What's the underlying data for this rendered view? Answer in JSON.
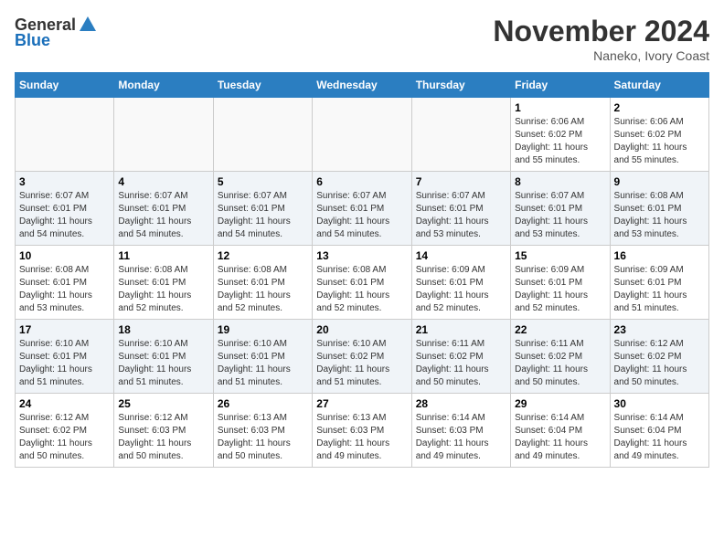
{
  "header": {
    "logo_general": "General",
    "logo_blue": "Blue",
    "month_title": "November 2024",
    "location": "Naneko, Ivory Coast"
  },
  "weekdays": [
    "Sunday",
    "Monday",
    "Tuesday",
    "Wednesday",
    "Thursday",
    "Friday",
    "Saturday"
  ],
  "weeks": [
    [
      {
        "day": "",
        "info": ""
      },
      {
        "day": "",
        "info": ""
      },
      {
        "day": "",
        "info": ""
      },
      {
        "day": "",
        "info": ""
      },
      {
        "day": "",
        "info": ""
      },
      {
        "day": "1",
        "info": "Sunrise: 6:06 AM\nSunset: 6:02 PM\nDaylight: 11 hours\nand 55 minutes."
      },
      {
        "day": "2",
        "info": "Sunrise: 6:06 AM\nSunset: 6:02 PM\nDaylight: 11 hours\nand 55 minutes."
      }
    ],
    [
      {
        "day": "3",
        "info": "Sunrise: 6:07 AM\nSunset: 6:01 PM\nDaylight: 11 hours\nand 54 minutes."
      },
      {
        "day": "4",
        "info": "Sunrise: 6:07 AM\nSunset: 6:01 PM\nDaylight: 11 hours\nand 54 minutes."
      },
      {
        "day": "5",
        "info": "Sunrise: 6:07 AM\nSunset: 6:01 PM\nDaylight: 11 hours\nand 54 minutes."
      },
      {
        "day": "6",
        "info": "Sunrise: 6:07 AM\nSunset: 6:01 PM\nDaylight: 11 hours\nand 54 minutes."
      },
      {
        "day": "7",
        "info": "Sunrise: 6:07 AM\nSunset: 6:01 PM\nDaylight: 11 hours\nand 53 minutes."
      },
      {
        "day": "8",
        "info": "Sunrise: 6:07 AM\nSunset: 6:01 PM\nDaylight: 11 hours\nand 53 minutes."
      },
      {
        "day": "9",
        "info": "Sunrise: 6:08 AM\nSunset: 6:01 PM\nDaylight: 11 hours\nand 53 minutes."
      }
    ],
    [
      {
        "day": "10",
        "info": "Sunrise: 6:08 AM\nSunset: 6:01 PM\nDaylight: 11 hours\nand 53 minutes."
      },
      {
        "day": "11",
        "info": "Sunrise: 6:08 AM\nSunset: 6:01 PM\nDaylight: 11 hours\nand 52 minutes."
      },
      {
        "day": "12",
        "info": "Sunrise: 6:08 AM\nSunset: 6:01 PM\nDaylight: 11 hours\nand 52 minutes."
      },
      {
        "day": "13",
        "info": "Sunrise: 6:08 AM\nSunset: 6:01 PM\nDaylight: 11 hours\nand 52 minutes."
      },
      {
        "day": "14",
        "info": "Sunrise: 6:09 AM\nSunset: 6:01 PM\nDaylight: 11 hours\nand 52 minutes."
      },
      {
        "day": "15",
        "info": "Sunrise: 6:09 AM\nSunset: 6:01 PM\nDaylight: 11 hours\nand 52 minutes."
      },
      {
        "day": "16",
        "info": "Sunrise: 6:09 AM\nSunset: 6:01 PM\nDaylight: 11 hours\nand 51 minutes."
      }
    ],
    [
      {
        "day": "17",
        "info": "Sunrise: 6:10 AM\nSunset: 6:01 PM\nDaylight: 11 hours\nand 51 minutes."
      },
      {
        "day": "18",
        "info": "Sunrise: 6:10 AM\nSunset: 6:01 PM\nDaylight: 11 hours\nand 51 minutes."
      },
      {
        "day": "19",
        "info": "Sunrise: 6:10 AM\nSunset: 6:01 PM\nDaylight: 11 hours\nand 51 minutes."
      },
      {
        "day": "20",
        "info": "Sunrise: 6:10 AM\nSunset: 6:02 PM\nDaylight: 11 hours\nand 51 minutes."
      },
      {
        "day": "21",
        "info": "Sunrise: 6:11 AM\nSunset: 6:02 PM\nDaylight: 11 hours\nand 50 minutes."
      },
      {
        "day": "22",
        "info": "Sunrise: 6:11 AM\nSunset: 6:02 PM\nDaylight: 11 hours\nand 50 minutes."
      },
      {
        "day": "23",
        "info": "Sunrise: 6:12 AM\nSunset: 6:02 PM\nDaylight: 11 hours\nand 50 minutes."
      }
    ],
    [
      {
        "day": "24",
        "info": "Sunrise: 6:12 AM\nSunset: 6:02 PM\nDaylight: 11 hours\nand 50 minutes."
      },
      {
        "day": "25",
        "info": "Sunrise: 6:12 AM\nSunset: 6:03 PM\nDaylight: 11 hours\nand 50 minutes."
      },
      {
        "day": "26",
        "info": "Sunrise: 6:13 AM\nSunset: 6:03 PM\nDaylight: 11 hours\nand 50 minutes."
      },
      {
        "day": "27",
        "info": "Sunrise: 6:13 AM\nSunset: 6:03 PM\nDaylight: 11 hours\nand 49 minutes."
      },
      {
        "day": "28",
        "info": "Sunrise: 6:14 AM\nSunset: 6:03 PM\nDaylight: 11 hours\nand 49 minutes."
      },
      {
        "day": "29",
        "info": "Sunrise: 6:14 AM\nSunset: 6:04 PM\nDaylight: 11 hours\nand 49 minutes."
      },
      {
        "day": "30",
        "info": "Sunrise: 6:14 AM\nSunset: 6:04 PM\nDaylight: 11 hours\nand 49 minutes."
      }
    ]
  ]
}
